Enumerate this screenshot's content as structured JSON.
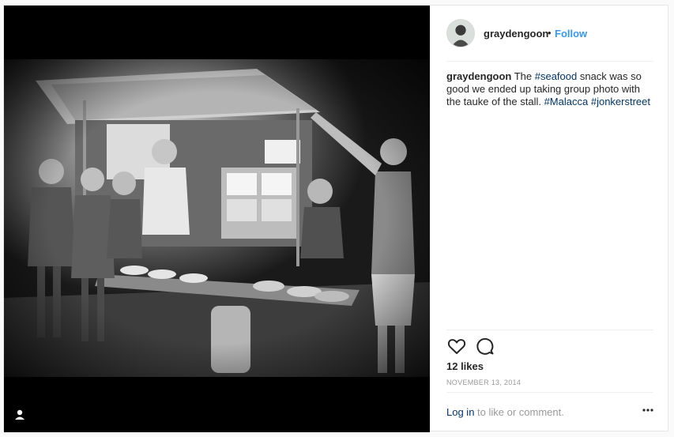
{
  "post": {
    "username": "graydengoon",
    "separator": "•",
    "follow_label": "Follow",
    "caption": {
      "username": "graydengoon",
      "text_1": " The ",
      "tag_seafood": "#seafood",
      "text_2": " snack was so good we ended up taking group photo with the tauke of the stall. ",
      "tag_malacca": "#Malacca",
      "tag_jonker": "#jonkerstreet"
    },
    "likes_label": "12 likes",
    "date": "NOVEMBER 13, 2014",
    "login_link": "Log in",
    "login_suffix": " to like or comment."
  },
  "icons": {
    "like": "heart-icon",
    "comment": "comment-icon",
    "more": "more-options-icon",
    "tag": "tagged-user-icon"
  },
  "colors": {
    "link_blue": "#3897f0",
    "hashtag": "#003569",
    "muted": "#999999",
    "divider": "#efefef"
  }
}
